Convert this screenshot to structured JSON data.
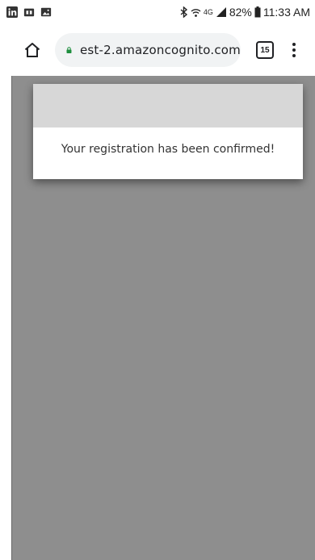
{
  "status_bar": {
    "battery": "82%",
    "time": "11:33 AM",
    "network": "4G",
    "left_icons": [
      "linkedin-icon",
      "sim-card-icon",
      "image-icon"
    ],
    "right_icons": [
      "bluetooth-icon",
      "wifi-icon",
      "signal-icon",
      "battery-icon"
    ]
  },
  "browser": {
    "url": "est-2.amazoncognito.com",
    "tab_count": "15",
    "lock_color": "#1e8e3e"
  },
  "dialog": {
    "message": "Your registration has been confirmed!"
  },
  "colors": {
    "page_background": "#8e8e8e",
    "dialog_header": "#d7d7d7"
  }
}
